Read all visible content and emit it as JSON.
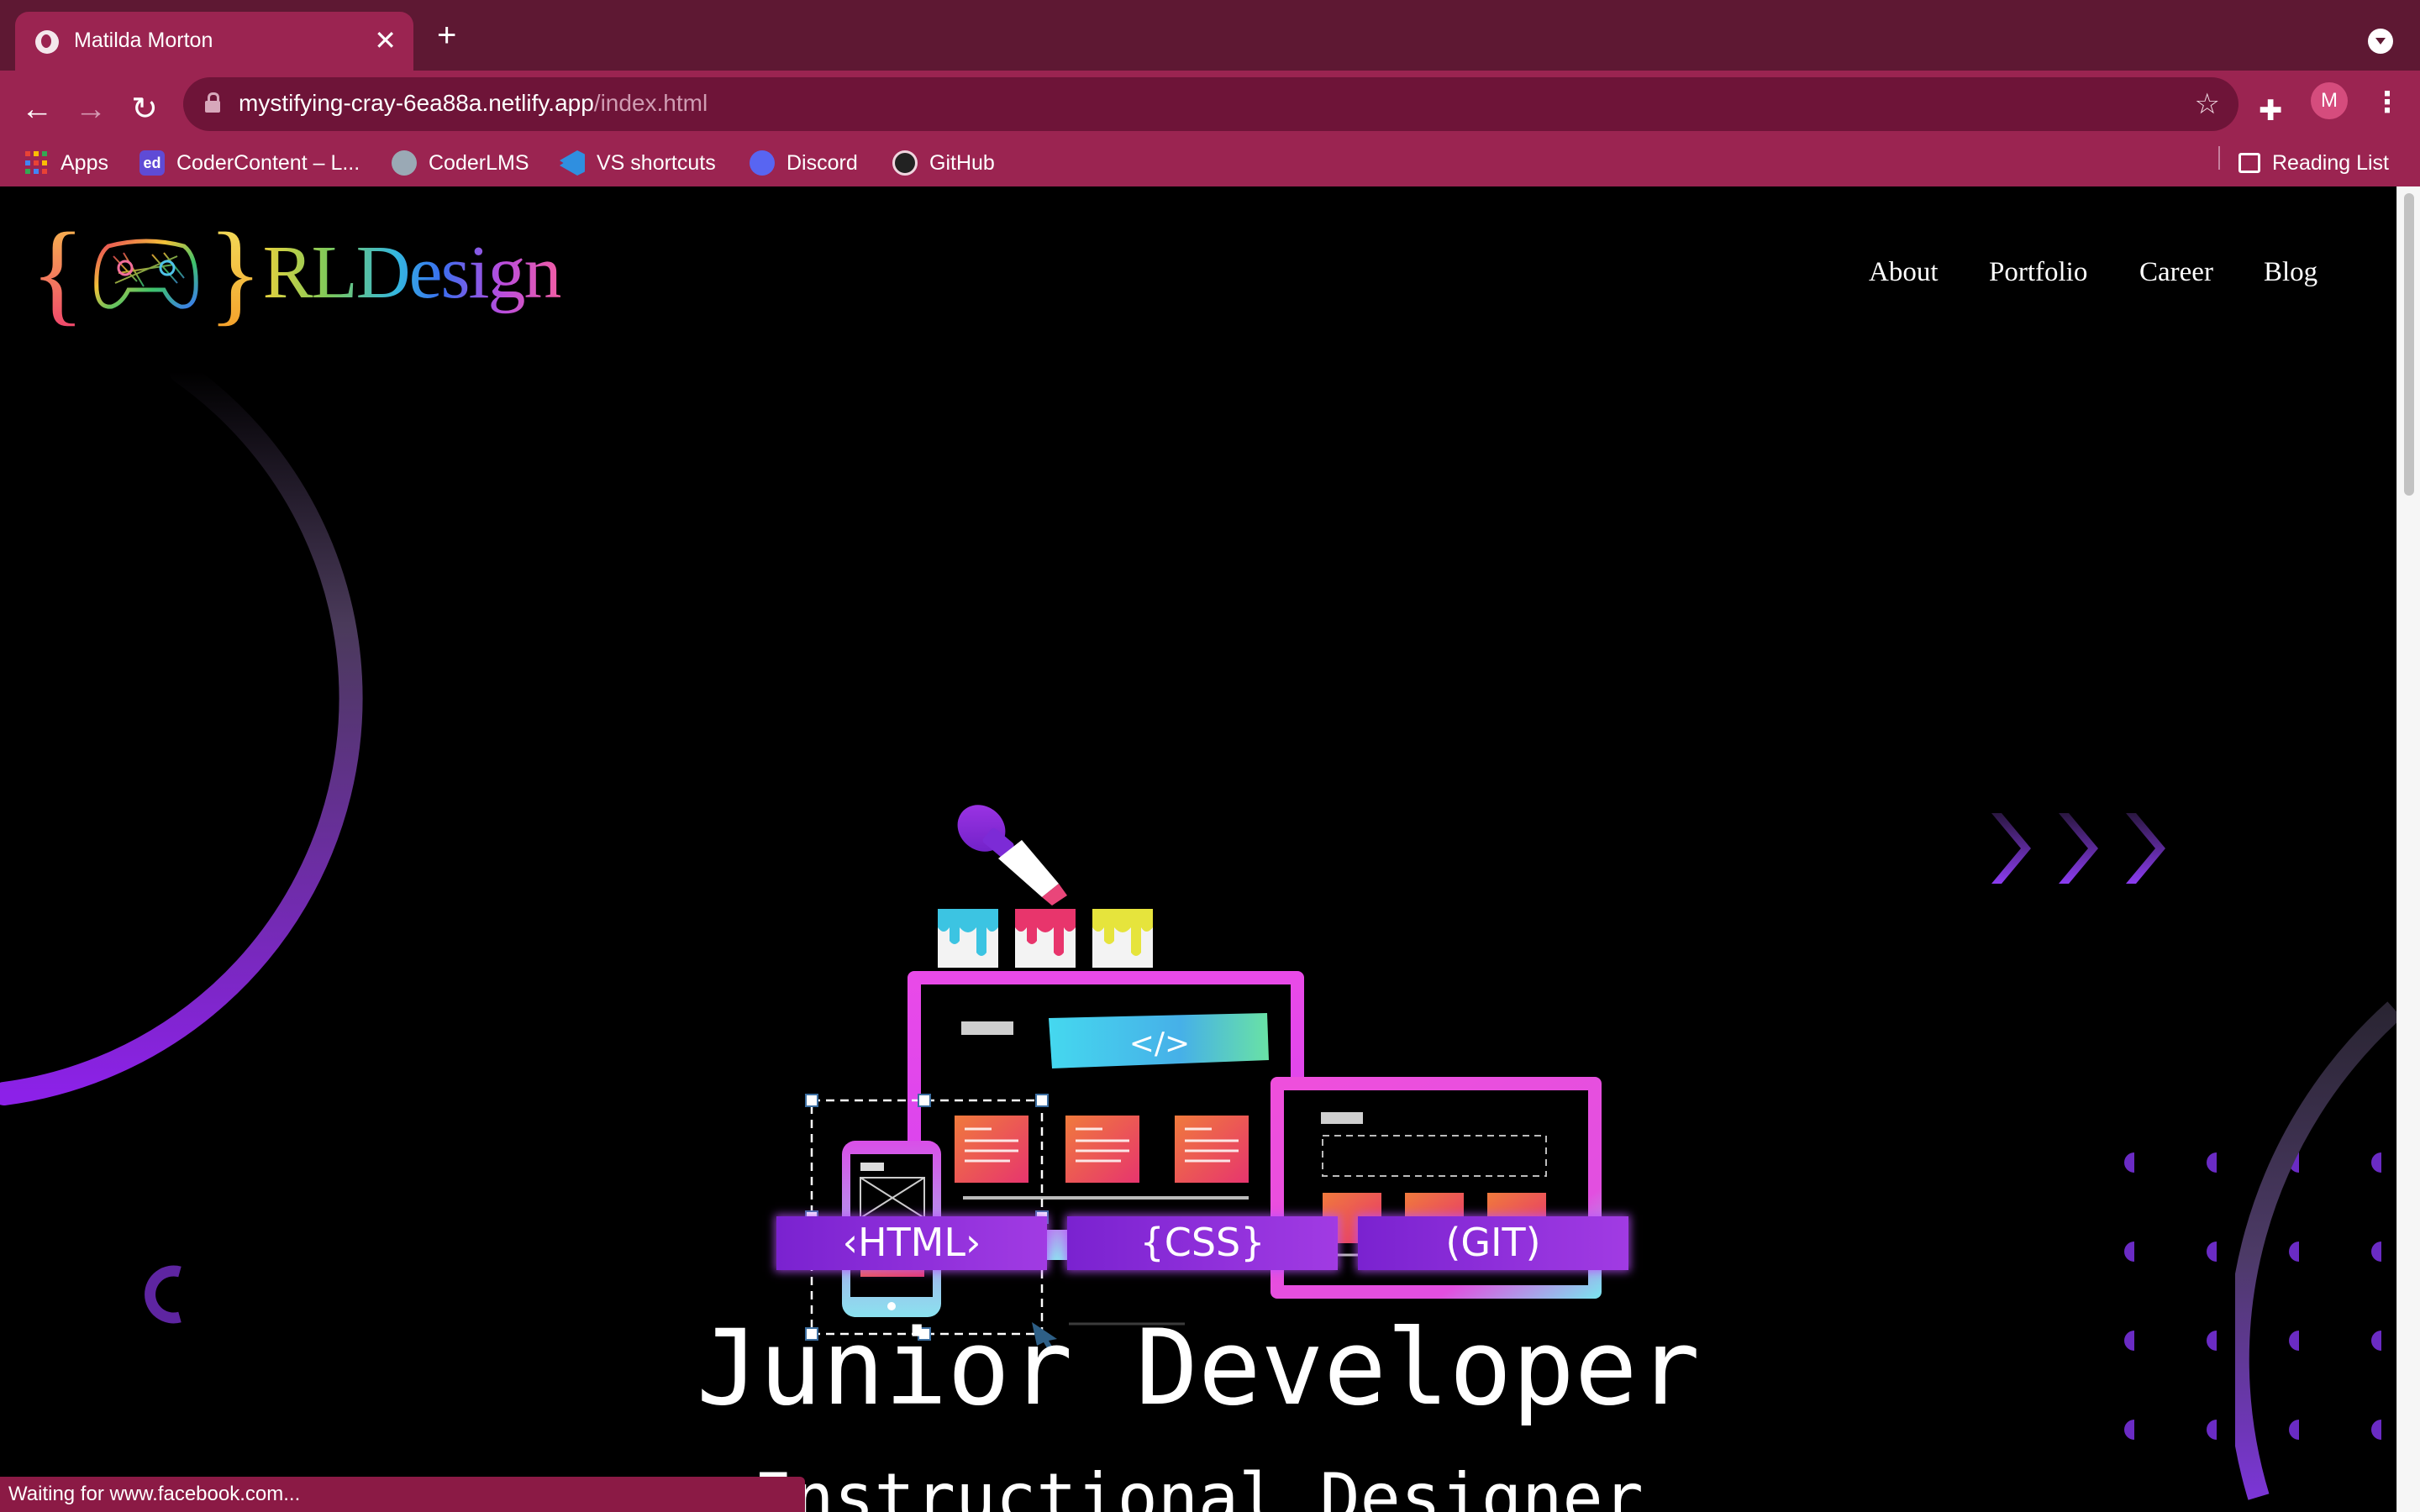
{
  "browser": {
    "tab_title": "Matilda Morton",
    "new_tab_icon": "plus-icon",
    "url_host": "mystifying-cray-6ea88a.netlify.app",
    "url_path": "/index.html",
    "profile_initial": "M",
    "bookmarks": [
      {
        "label": "Apps",
        "icon": "apps-grid-icon"
      },
      {
        "label": "CoderContent – L...",
        "icon": "ed-icon",
        "color": "#5f4bd6"
      },
      {
        "label": "CoderLMS",
        "icon": "lms-icon",
        "color": "#9aa9b5"
      },
      {
        "label": "VS shortcuts",
        "icon": "vscode-icon",
        "color": "#2f8fe0"
      },
      {
        "label": "Discord",
        "icon": "discord-icon",
        "color": "#5865f2"
      },
      {
        "label": "GitHub",
        "icon": "github-icon",
        "color": "#222222"
      }
    ],
    "reading_list": "Reading List",
    "status": "Waiting for www.facebook.com..."
  },
  "site": {
    "logo_word": "RLDesign",
    "nav": [
      "About",
      "Portfolio",
      "Career",
      "Blog"
    ],
    "badges": [
      "‹HTML›",
      "{CSS}",
      "(GIT)"
    ],
    "headline": "Junior Developer",
    "subheadline": "Instructional Designer"
  },
  "colors": {
    "tab_bar": "#5e1833",
    "toolbar": "#9b2451",
    "accent_purple": "#8a2be2",
    "accent_pink": "#e84fb4",
    "page_background": "#000000"
  }
}
